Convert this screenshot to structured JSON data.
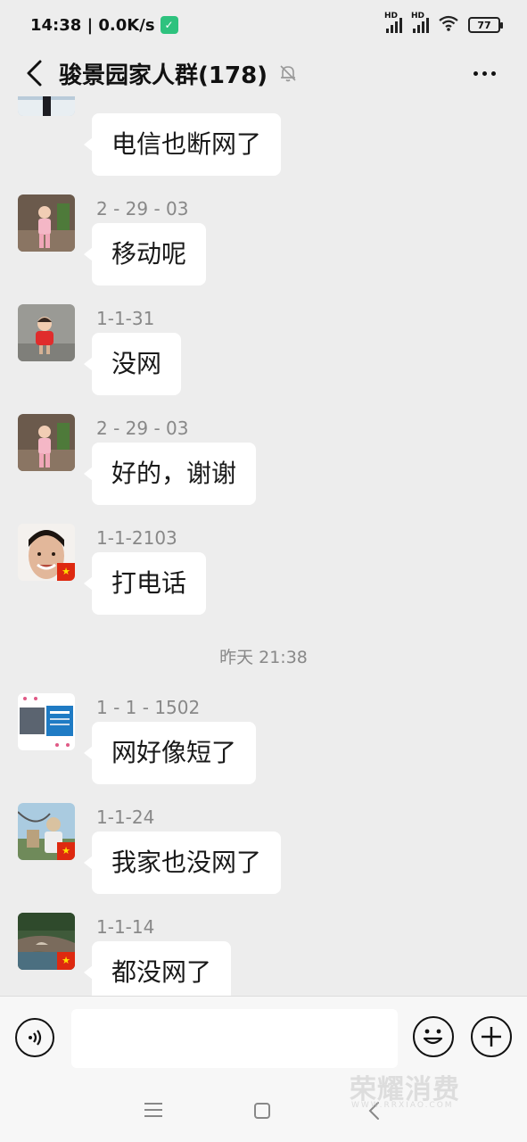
{
  "status_bar": {
    "time_speed": "14:38 | 0.0K/s",
    "hd1": "HD",
    "hd2": "HD",
    "battery": "77"
  },
  "header": {
    "title": "骏景园家人群(178)"
  },
  "messages": [
    {
      "sender": "",
      "text": "电信也断网了"
    },
    {
      "sender": "2 - 29 - 03",
      "text": "移动呢"
    },
    {
      "sender": "1-1-31",
      "text": "没网"
    },
    {
      "sender": "2 - 29 - 03",
      "text": "好的，谢谢"
    },
    {
      "sender": "1-1-2103",
      "text": "打电话"
    },
    {
      "sender": "1 - 1 - 1502",
      "text": "网好像短了"
    },
    {
      "sender": "1-1-24",
      "text": "我家也没网了"
    },
    {
      "sender": "1-1-14",
      "text": "都没网了"
    }
  ],
  "time_separator": "昨天 21:38",
  "input": {
    "value": ""
  },
  "watermark": {
    "text": "荣耀消费",
    "sub": "WWW.RRXIAO.COM"
  },
  "colors": {
    "chat_bg": "#ededed",
    "bubble": "#ffffff",
    "meta_text": "#888888"
  }
}
